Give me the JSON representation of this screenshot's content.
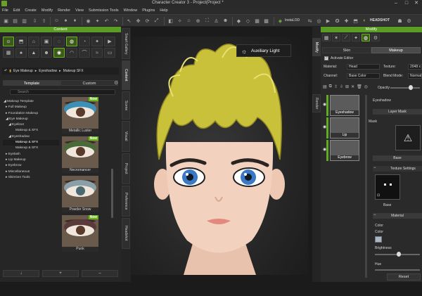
{
  "window": {
    "title": "Character Creator 3 - Project(Project *",
    "controls": {
      "minimize": "–",
      "maximize": "□",
      "close": "✕"
    }
  },
  "menu": [
    "File",
    "Edit",
    "Create",
    "Modify",
    "Render",
    "View",
    "Submission Tools",
    "Window",
    "Plugins",
    "Help"
  ],
  "toolbar": {
    "instaldo": "InstaLOD",
    "headshot": "HEADSHOT",
    "icons": [
      "open-icon",
      "save-icon",
      "select-icon",
      "move-icon",
      "rotate-icon",
      "scale-icon",
      "camera-icon",
      "light-icon",
      "render-icon"
    ]
  },
  "content_panel": {
    "title": "Content",
    "breadcrumb": [
      "Eye Makeup",
      "Eyeshadow",
      "Makeup SFX"
    ],
    "tabs": [
      {
        "label": "Template",
        "selected": true
      },
      {
        "label": "Custom",
        "selected": false
      }
    ],
    "search_placeholder": "Search",
    "tree": [
      {
        "label": "◢ Makeup Template",
        "indent": 0
      },
      {
        "label": "▸ Full Makeup",
        "indent": 1
      },
      {
        "label": "▸ Foundation Makeup",
        "indent": 1
      },
      {
        "label": "◢ Eye Makeup",
        "indent": 1
      },
      {
        "label": "◢ Eyeliner",
        "indent": 2
      },
      {
        "label": "Makeup & SFX",
        "indent": 3
      },
      {
        "label": "◢ Eyeshadow",
        "indent": 2
      },
      {
        "label": "Makeup & SFX",
        "indent": 3,
        "selected": true
      },
      {
        "label": "Makeup & SFX",
        "indent": 2
      },
      {
        "label": "▸ Eyelash",
        "indent": 1
      },
      {
        "label": "▸ Lip Makeup",
        "indent": 1
      },
      {
        "label": "▸ Eyebrow",
        "indent": 1
      },
      {
        "label": "▸ Miscellaneous",
        "indent": 1
      },
      {
        "label": "▸ SkinGen Tools",
        "indent": 1
      }
    ],
    "thumbnails": [
      {
        "label": "Metallic Luster",
        "new": "New",
        "shadow": "#3d8fb5"
      },
      {
        "label": "Necromancer",
        "new": "New",
        "shadow": "#4a6a3a"
      },
      {
        "label": "Powder Snow",
        "new": "",
        "shadow": "#8aa0a8"
      },
      {
        "label": "Punk",
        "new": "New",
        "shadow": "#5a3a3a"
      }
    ],
    "bottom_buttons": [
      "↓",
      "+",
      "–"
    ]
  },
  "side_tabs_left": [
    "Smart Gallery",
    "Content",
    "Scene",
    "Visual",
    "Project",
    "Preference",
    "Headshot"
  ],
  "side_tabs_right": [
    "Modify",
    "Render"
  ],
  "viewport": {
    "auxiliary_light": "Auxiliary Light"
  },
  "modify_panel": {
    "title": "Modify",
    "tabs": [
      {
        "label": "Skin",
        "selected": false
      },
      {
        "label": "Makeup",
        "selected": true
      }
    ],
    "activate_editor": "Activate Editor",
    "material_label": "Material:",
    "material_value": "Head",
    "texture_label": "Texture:",
    "texture_value": "2048 x",
    "channel_label": "Channel:",
    "channel_value": "Base Color",
    "blend_label": "Blend Mode:",
    "blend_value": "Normal",
    "opacity_label": "Opacity",
    "layers": [
      {
        "label": "Eyeshadow"
      },
      {
        "label": "Lip"
      },
      {
        "label": "Eyebrow"
      }
    ],
    "eyeshadow_header": "Eyeshadow",
    "layer_mask": "Layer Mask",
    "mask_label": "Mask",
    "base_header": "Base",
    "texture_settings": "Texture Settings",
    "base_label": "Base",
    "material_header": "Material",
    "color_header": "Color",
    "color_label": "Color",
    "brightness_label": "Brightness",
    "hue_label": "Hue",
    "reset": "Reset"
  }
}
